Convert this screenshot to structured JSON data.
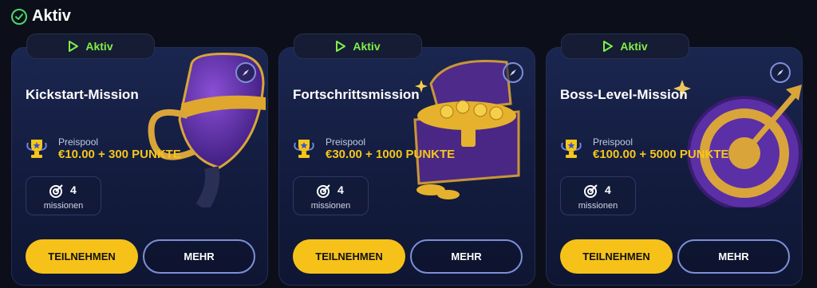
{
  "section": {
    "title": "Aktiv"
  },
  "colors": {
    "accent_green": "#7ef048",
    "gold": "#f5c61c",
    "button_yellow": "#f6c21a",
    "outline_blue": "#7d8fd8"
  },
  "cards": [
    {
      "status": "Aktiv",
      "title": "Kickstart-Mission",
      "art_icon": "trophy-cup-icon",
      "pool_label": "Preispool",
      "pool_value": "€10.00 + 300 PUNKTE",
      "missions_count": "4",
      "missions_label": "missionen",
      "join_label": "TEILNEHMEN",
      "more_label": "MEHR"
    },
    {
      "status": "Aktiv",
      "title": "Fortschrittsmission",
      "art_icon": "treasure-chest-icon",
      "pool_label": "Preispool",
      "pool_value": "€30.00 + 1000 PUNKTE",
      "missions_count": "4",
      "missions_label": "missionen",
      "join_label": "TEILNEHMEN",
      "more_label": "MEHR"
    },
    {
      "status": "Aktiv",
      "title": "Boss-Level-Mission",
      "art_icon": "target-arrow-icon",
      "pool_label": "Preispool",
      "pool_value": "€100.00 + 5000 PUNKTE",
      "missions_count": "4",
      "missions_label": "missionen",
      "join_label": "TEILNEHMEN",
      "more_label": "MEHR"
    }
  ]
}
